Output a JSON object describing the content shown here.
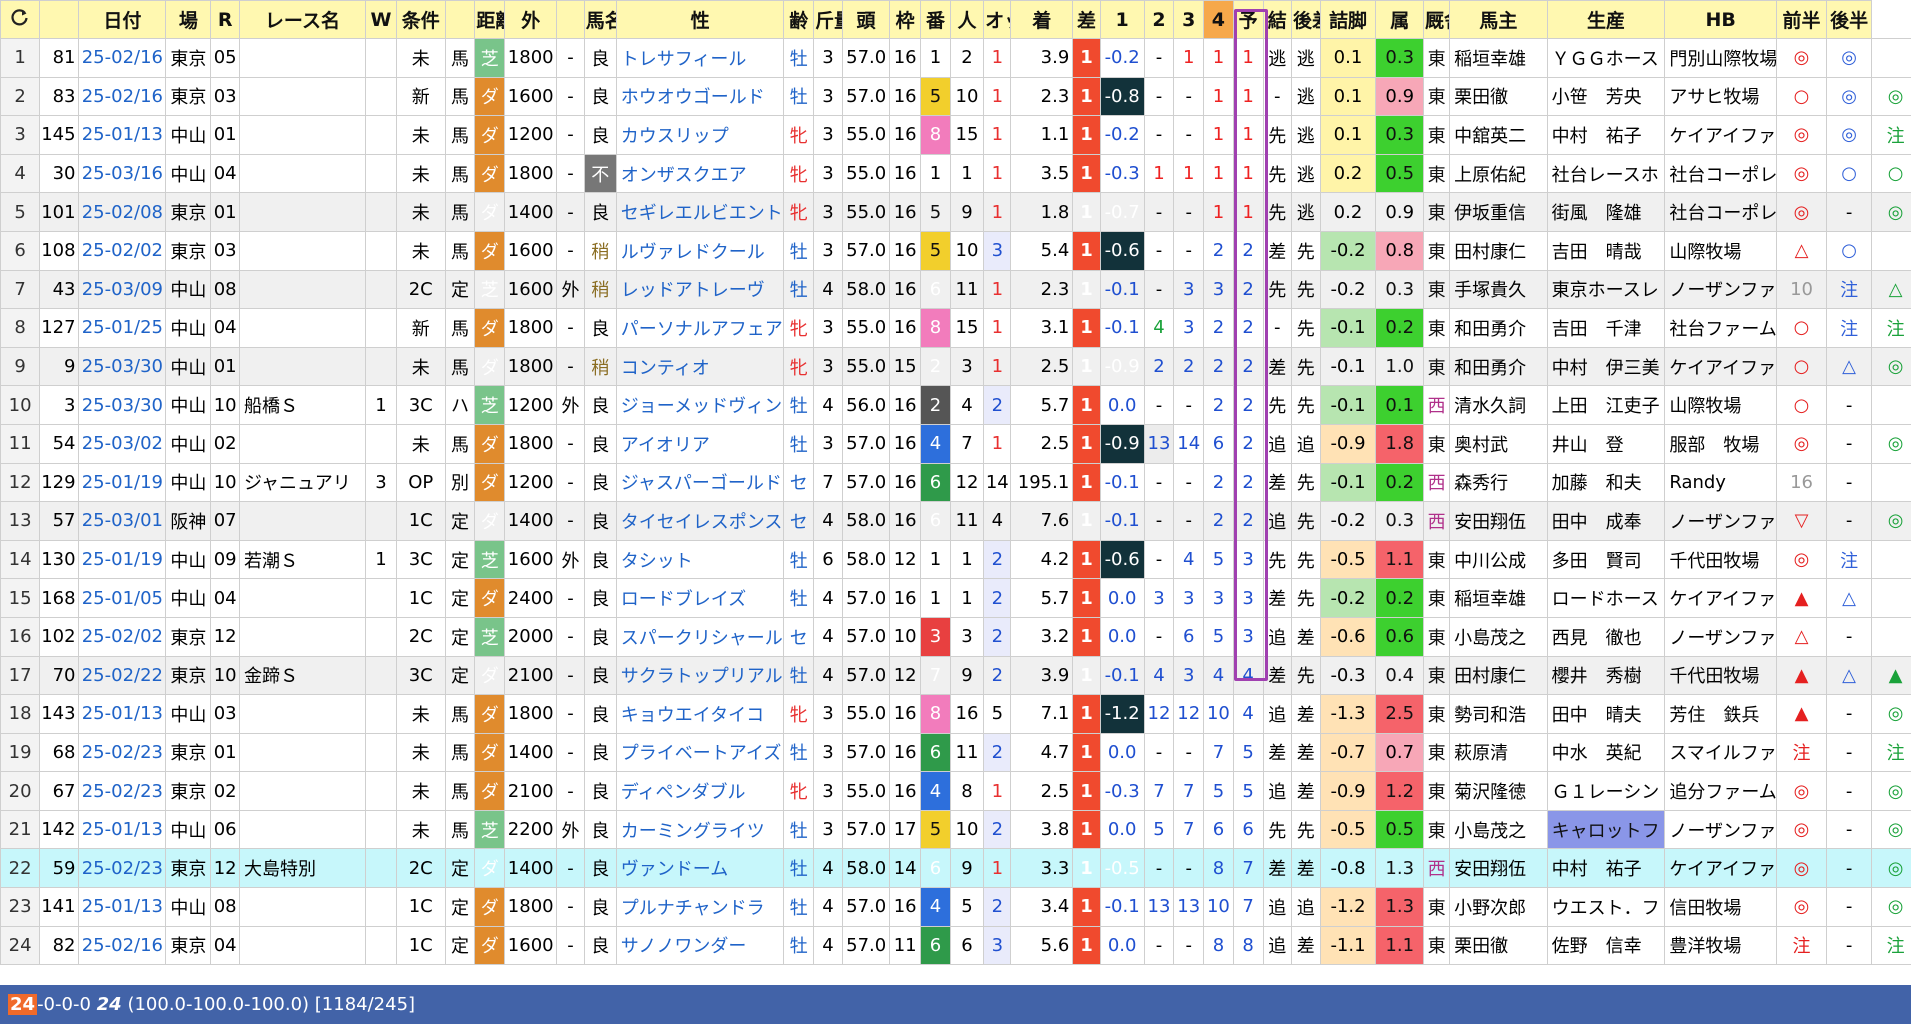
{
  "headers": [
    "refresh",
    "",
    "日付",
    "場",
    "R",
    "レース名",
    "W",
    "条件",
    "",
    "距離",
    "外",
    "",
    "馬名",
    "性",
    "齢",
    "斤量",
    "頭",
    "枠",
    "番",
    "人",
    "オッズ",
    "着",
    "差",
    "1",
    "2",
    "3",
    "4",
    "予",
    "結",
    "後差",
    "詰脚",
    "属",
    "厩舎",
    "馬主",
    "生産",
    "HB",
    "前半",
    "後半"
  ],
  "status": {
    "count": "24",
    "text": "-0-0-0",
    "count2": "24",
    "rest": "(100.0-100.0-100.0) [1184/245]"
  },
  "rows": [
    [
      "1",
      "81",
      "25-02/16",
      "東京",
      "05",
      "",
      "",
      "未",
      "馬",
      "芝",
      "1800",
      "-",
      "良",
      "トレサフィール",
      "牡",
      "3",
      "57.0",
      "16",
      "1",
      "2",
      "1",
      "3.9",
      "1",
      "-0.2",
      "-",
      "1",
      "1",
      "1",
      "逃",
      "逃",
      "0.1",
      "0.3",
      "東",
      "稲垣幸雄",
      "ＹＧＧホース",
      "門別山際牧場",
      "◎",
      "◎",
      ""
    ],
    [
      "2",
      "83",
      "25-02/16",
      "東京",
      "03",
      "",
      "",
      "新",
      "馬",
      "ダ",
      "1600",
      "-",
      "良",
      "ホウオウゴールド",
      "牡",
      "3",
      "57.0",
      "16",
      "5",
      "10",
      "1",
      "2.3",
      "1",
      "-0.8",
      "-",
      "-",
      "1",
      "1",
      "-",
      "逃",
      "0.1",
      "0.9",
      "東",
      "栗田徹",
      "小笹　芳央",
      "アサヒ牧場",
      "○",
      "◎",
      "◎"
    ],
    [
      "3",
      "145",
      "25-01/13",
      "中山",
      "01",
      "",
      "",
      "未",
      "馬",
      "ダ",
      "1200",
      "-",
      "良",
      "カウスリップ",
      "牝",
      "3",
      "55.0",
      "16",
      "8",
      "15",
      "1",
      "1.1",
      "1",
      "-0.2",
      "-",
      "-",
      "1",
      "1",
      "先",
      "逃",
      "0.1",
      "0.3",
      "東",
      "中舘英二",
      "中村　祐子",
      "ケイアイファ",
      "◎",
      "◎",
      "注"
    ],
    [
      "4",
      "30",
      "25-03/16",
      "中山",
      "04",
      "",
      "",
      "未",
      "馬",
      "ダ",
      "1800",
      "-",
      "不",
      "オンザスクエア",
      "牝",
      "3",
      "55.0",
      "16",
      "1",
      "1",
      "1",
      "3.5",
      "1",
      "-0.3",
      "1",
      "1",
      "1",
      "1",
      "先",
      "逃",
      "0.2",
      "0.5",
      "東",
      "上原佑紀",
      "社台レースホ",
      "社台コーポレ",
      "◎",
      "○",
      "○"
    ],
    [
      "5",
      "101",
      "25-02/08",
      "東京",
      "01",
      "",
      "",
      "未",
      "馬",
      "ダ",
      "1400",
      "-",
      "良",
      "セギレエルビエント",
      "牝",
      "3",
      "55.0",
      "16",
      "5",
      "9",
      "1",
      "1.8",
      "1",
      "-0.7",
      "-",
      "-",
      "1",
      "1",
      "先",
      "逃",
      "0.2",
      "0.9",
      "東",
      "伊坂重信",
      "街風　隆雄",
      "社台コーポレ",
      "◎",
      "-",
      "◎"
    ],
    [
      "6",
      "108",
      "25-02/02",
      "東京",
      "03",
      "",
      "",
      "未",
      "馬",
      "ダ",
      "1600",
      "-",
      "稍",
      "ルヴァレドクール",
      "牡",
      "3",
      "57.0",
      "16",
      "5",
      "10",
      "3",
      "5.4",
      "1",
      "-0.6",
      "-",
      "-",
      "2",
      "2",
      "差",
      "先",
      "-0.2",
      "0.8",
      "東",
      "田村康仁",
      "吉田　晴哉",
      "山際牧場",
      "△",
      "○",
      ""
    ],
    [
      "7",
      "43",
      "25-03/09",
      "中山",
      "08",
      "",
      "",
      "2C",
      "定",
      "芝",
      "1600",
      "外",
      "稍",
      "レッドアトレーヴ",
      "牡",
      "4",
      "58.0",
      "16",
      "6",
      "11",
      "1",
      "2.3",
      "1",
      "-0.1",
      "-",
      "3",
      "3",
      "2",
      "先",
      "先",
      "-0.2",
      "0.3",
      "東",
      "手塚貴久",
      "東京ホースレ",
      "ノーザンファ",
      "10",
      "注",
      "△"
    ],
    [
      "8",
      "127",
      "25-01/25",
      "中山",
      "04",
      "",
      "",
      "新",
      "馬",
      "ダ",
      "1800",
      "-",
      "良",
      "パーソナルアフェア",
      "牝",
      "3",
      "55.0",
      "16",
      "8",
      "15",
      "1",
      "3.1",
      "1",
      "-0.1",
      "4",
      "3",
      "2",
      "2",
      "-",
      "先",
      "-0.1",
      "0.2",
      "東",
      "和田勇介",
      "吉田　千津",
      "社台ファーム",
      "○",
      "注",
      "注"
    ],
    [
      "9",
      "9",
      "25-03/30",
      "中山",
      "01",
      "",
      "",
      "未",
      "馬",
      "ダ",
      "1800",
      "-",
      "稍",
      "コンティオ",
      "牝",
      "3",
      "55.0",
      "15",
      "2",
      "3",
      "1",
      "2.5",
      "1",
      "-0.9",
      "2",
      "2",
      "2",
      "2",
      "差",
      "先",
      "-0.1",
      "1.0",
      "東",
      "和田勇介",
      "中村　伊三美",
      "ケイアイファ",
      "○",
      "△",
      "◎"
    ],
    [
      "10",
      "3",
      "25-03/30",
      "中山",
      "10",
      "船橋Ｓ",
      "1",
      "3C",
      "ハ",
      "芝",
      "1200",
      "外",
      "良",
      "ジョーメッドヴィン",
      "牡",
      "4",
      "56.0",
      "16",
      "2",
      "4",
      "2",
      "5.7",
      "1",
      "0.0",
      "-",
      "-",
      "2",
      "2",
      "先",
      "先",
      "-0.1",
      "0.1",
      "西",
      "清水久詞",
      "上田　江吏子",
      "山際牧場",
      "○",
      "-",
      ""
    ],
    [
      "11",
      "54",
      "25-03/02",
      "中山",
      "02",
      "",
      "",
      "未",
      "馬",
      "ダ",
      "1800",
      "-",
      "良",
      "アイオリア",
      "牡",
      "3",
      "57.0",
      "16",
      "4",
      "7",
      "1",
      "2.5",
      "1",
      "-0.9",
      "13",
      "14",
      "6",
      "2",
      "追",
      "追",
      "-0.9",
      "1.8",
      "東",
      "奥村武",
      "井山　登",
      "服部　牧場",
      "◎",
      "-",
      "◎"
    ],
    [
      "12",
      "129",
      "25-01/19",
      "中山",
      "10",
      "ジャニュアリ",
      "3",
      "OP",
      "別",
      "ダ",
      "1200",
      "-",
      "良",
      "ジャスパーゴールド",
      "セ",
      "7",
      "57.0",
      "16",
      "6",
      "12",
      "14",
      "195.1",
      "1",
      "-0.1",
      "-",
      "-",
      "2",
      "2",
      "差",
      "先",
      "-0.1",
      "0.2",
      "西",
      "森秀行",
      "加藤　和夫",
      "Randy",
      "16",
      "-",
      ""
    ],
    [
      "13",
      "57",
      "25-03/01",
      "阪神",
      "07",
      "",
      "",
      "1C",
      "定",
      "ダ",
      "1400",
      "-",
      "良",
      "タイセイレスポンス",
      "セ",
      "4",
      "58.0",
      "16",
      "6",
      "11",
      "4",
      "7.6",
      "1",
      "-0.1",
      "-",
      "-",
      "2",
      "2",
      "追",
      "先",
      "-0.2",
      "0.3",
      "西",
      "安田翔伍",
      "田中　成奉",
      "ノーザンファ",
      "▽",
      "-",
      "◎"
    ],
    [
      "14",
      "130",
      "25-01/19",
      "中山",
      "09",
      "若潮Ｓ",
      "1",
      "3C",
      "定",
      "芝",
      "1600",
      "外",
      "良",
      "タシット",
      "牡",
      "6",
      "58.0",
      "12",
      "1",
      "1",
      "2",
      "4.2",
      "1",
      "-0.6",
      "-",
      "4",
      "5",
      "3",
      "先",
      "先",
      "-0.5",
      "1.1",
      "東",
      "中川公成",
      "多田　賢司",
      "千代田牧場",
      "◎",
      "注",
      ""
    ],
    [
      "15",
      "168",
      "25-01/05",
      "中山",
      "04",
      "",
      "",
      "1C",
      "定",
      "ダ",
      "2400",
      "-",
      "良",
      "ロードブレイズ",
      "牡",
      "4",
      "57.0",
      "16",
      "1",
      "1",
      "2",
      "5.7",
      "1",
      "0.0",
      "3",
      "3",
      "3",
      "3",
      "差",
      "先",
      "-0.2",
      "0.2",
      "東",
      "稲垣幸雄",
      "ロードホース",
      "ケイアイファ",
      "▲",
      "△",
      ""
    ],
    [
      "16",
      "102",
      "25-02/02",
      "東京",
      "12",
      "",
      "",
      "2C",
      "定",
      "芝",
      "2000",
      "-",
      "良",
      "スパークリシャール",
      "セ",
      "4",
      "57.0",
      "10",
      "3",
      "3",
      "2",
      "3.2",
      "1",
      "0.0",
      "-",
      "6",
      "5",
      "3",
      "追",
      "差",
      "-0.6",
      "0.6",
      "東",
      "小島茂之",
      "西見　徹也",
      "ノーザンファ",
      "△",
      "-",
      ""
    ],
    [
      "17",
      "70",
      "25-02/22",
      "東京",
      "10",
      "金蹄Ｓ",
      "",
      "3C",
      "定",
      "ダ",
      "2100",
      "-",
      "良",
      "サクラトップリアル",
      "牡",
      "4",
      "57.0",
      "12",
      "7",
      "9",
      "2",
      "3.9",
      "1",
      "-0.1",
      "4",
      "3",
      "4",
      "4",
      "差",
      "先",
      "-0.3",
      "0.4",
      "東",
      "田村康仁",
      "櫻井　秀樹",
      "千代田牧場",
      "▲",
      "△",
      "▲"
    ],
    [
      "18",
      "143",
      "25-01/13",
      "中山",
      "03",
      "",
      "",
      "未",
      "馬",
      "ダ",
      "1800",
      "-",
      "良",
      "キョウエイタイコ",
      "牝",
      "3",
      "55.0",
      "16",
      "8",
      "16",
      "5",
      "7.1",
      "1",
      "-1.2",
      "12",
      "12",
      "10",
      "4",
      "追",
      "差",
      "-1.3",
      "2.5",
      "東",
      "勢司和浩",
      "田中　晴夫",
      "芳住　鉄兵",
      "▲",
      "-",
      "◎"
    ],
    [
      "19",
      "68",
      "25-02/23",
      "東京",
      "01",
      "",
      "",
      "未",
      "馬",
      "ダ",
      "1400",
      "-",
      "良",
      "プライベートアイズ",
      "牡",
      "3",
      "57.0",
      "16",
      "6",
      "11",
      "2",
      "4.7",
      "1",
      "0.0",
      "-",
      "-",
      "7",
      "5",
      "差",
      "差",
      "-0.7",
      "0.7",
      "東",
      "萩原清",
      "中水　英紀",
      "スマイルファ",
      "注",
      "-",
      "注"
    ],
    [
      "20",
      "67",
      "25-02/23",
      "東京",
      "02",
      "",
      "",
      "未",
      "馬",
      "ダ",
      "2100",
      "-",
      "良",
      "ディペンダブル",
      "牝",
      "3",
      "55.0",
      "16",
      "4",
      "8",
      "1",
      "2.5",
      "1",
      "-0.3",
      "7",
      "7",
      "5",
      "5",
      "追",
      "差",
      "-0.9",
      "1.2",
      "東",
      "菊沢隆徳",
      "Ｇ１レーシン",
      "追分ファーム",
      "◎",
      "-",
      "◎"
    ],
    [
      "21",
      "142",
      "25-01/13",
      "中山",
      "06",
      "",
      "",
      "未",
      "馬",
      "芝",
      "2200",
      "外",
      "良",
      "カーミングライツ",
      "牡",
      "3",
      "57.0",
      "17",
      "5",
      "10",
      "2",
      "3.8",
      "1",
      "0.0",
      "5",
      "7",
      "6",
      "6",
      "先",
      "先",
      "-0.5",
      "0.5",
      "東",
      "小島茂之",
      "キャロットフ",
      "ノーザンファ",
      "◎",
      "-",
      "◎"
    ],
    [
      "22",
      "59",
      "25-02/23",
      "東京",
      "12",
      "大島特別",
      "",
      "2C",
      "定",
      "ダ",
      "1400",
      "-",
      "良",
      "ヴァンドーム",
      "牡",
      "4",
      "58.0",
      "14",
      "6",
      "9",
      "1",
      "3.3",
      "1",
      "-0.5",
      "-",
      "-",
      "8",
      "7",
      "差",
      "差",
      "-0.8",
      "1.3",
      "西",
      "安田翔伍",
      "中村　祐子",
      "ケイアイファ",
      "◎",
      "-",
      "◎"
    ],
    [
      "23",
      "141",
      "25-01/13",
      "中山",
      "08",
      "",
      "",
      "1C",
      "定",
      "ダ",
      "1800",
      "-",
      "良",
      "プルナチャンドラ",
      "牡",
      "4",
      "57.0",
      "16",
      "4",
      "5",
      "2",
      "3.4",
      "1",
      "-0.1",
      "13",
      "13",
      "10",
      "7",
      "追",
      "追",
      "-1.2",
      "1.3",
      "東",
      "小野次郎",
      "ウエスト．フ",
      "信田牧場",
      "◎",
      "-",
      "◎"
    ],
    [
      "24",
      "82",
      "25-02/16",
      "東京",
      "04",
      "",
      "",
      "1C",
      "定",
      "ダ",
      "1600",
      "-",
      "良",
      "サノノワンダー",
      "牡",
      "4",
      "57.0",
      "11",
      "6",
      "6",
      "3",
      "5.6",
      "1",
      "0.0",
      "-",
      "-",
      "8",
      "8",
      "追",
      "差",
      "-1.1",
      "1.1",
      "東",
      "栗田徹",
      "佐野　信幸",
      "豊洋牧場",
      "注",
      "-",
      "注"
    ]
  ]
}
